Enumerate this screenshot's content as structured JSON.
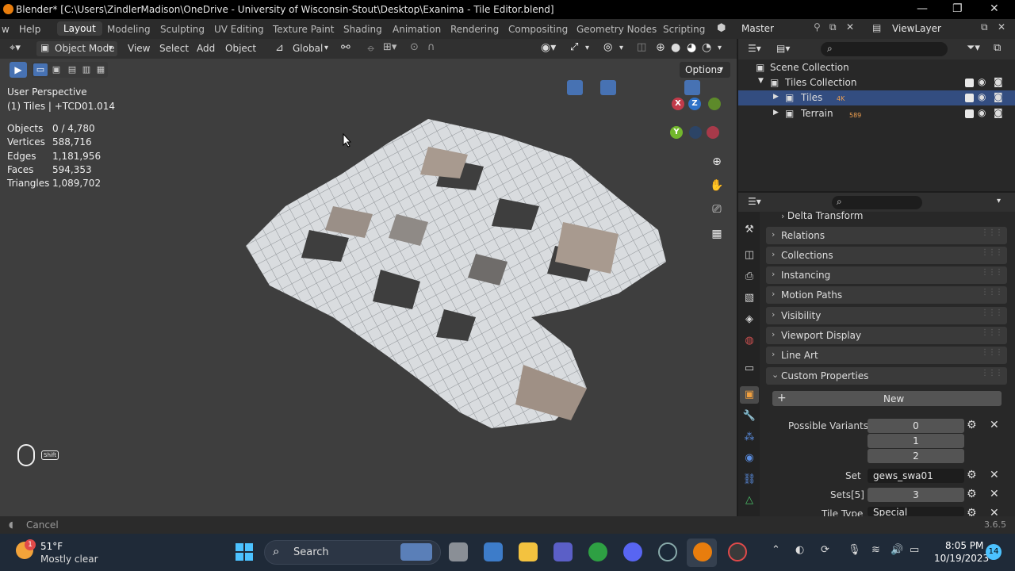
{
  "titlebar": {
    "title": "Blender* [C:\\Users\\ZindlerMadison\\OneDrive - University of Wisconsin-Stout\\Desktop\\Exanima - Tile Editor.blend]"
  },
  "menubar": {
    "items": [
      "w",
      "Help"
    ],
    "workspaces": [
      "Layout",
      "Modeling",
      "Sculpting",
      "UV Editing",
      "Texture Paint",
      "Shading",
      "Animation",
      "Rendering",
      "Compositing",
      "Geometry Nodes",
      "Scripting"
    ],
    "scene": "Master",
    "view_layer": "ViewLayer"
  },
  "viewport": {
    "mode": "Object Mode",
    "menus": [
      "View",
      "Select",
      "Add",
      "Object"
    ],
    "orientation": "Global",
    "options": "Options",
    "perspective": "User Perspective",
    "active": "(1) Tiles | +TCD01.014",
    "stats": [
      {
        "label": "Objects",
        "value": "0 / 4,780"
      },
      {
        "label": "Vertices",
        "value": "588,716"
      },
      {
        "label": "Edges",
        "value": "1,181,956"
      },
      {
        "label": "Faces",
        "value": "594,353"
      },
      {
        "label": "Triangles",
        "value": "1,089,702"
      }
    ],
    "gizmo": {
      "x": "X",
      "y": "Y",
      "z": "Z"
    },
    "shift_key": "Shift"
  },
  "outliner": {
    "rows": [
      {
        "label": "Scene Collection"
      },
      {
        "label": "Tiles Collection"
      },
      {
        "label": "Tiles",
        "badge": "4K"
      },
      {
        "label": "Terrain",
        "badge": "589"
      }
    ]
  },
  "properties": {
    "panels": [
      "Delta Transform",
      "Relations",
      "Collections",
      "Instancing",
      "Motion Paths",
      "Visibility",
      "Viewport Display",
      "Line Art",
      "Custom Properties"
    ],
    "new_button": "New",
    "custom": {
      "possible_variants_label": "Possible Variants",
      "possible_variants": [
        "0",
        "1",
        "2"
      ],
      "set_label": "Set",
      "set_value": "gews_swa01",
      "sets_label": "Sets[5]",
      "sets_value": "3",
      "tile_type_label": "Tile Type",
      "tile_type_value": "Special"
    }
  },
  "statusbar": {
    "cancel": "Cancel",
    "version": "3.6.5"
  },
  "taskbar": {
    "weather_temp": "51°F",
    "weather_desc": "Mostly clear",
    "weather_badge": "1",
    "search": "Search",
    "time": "8:05 PM",
    "date": "10/19/2023",
    "notifications": "14"
  }
}
